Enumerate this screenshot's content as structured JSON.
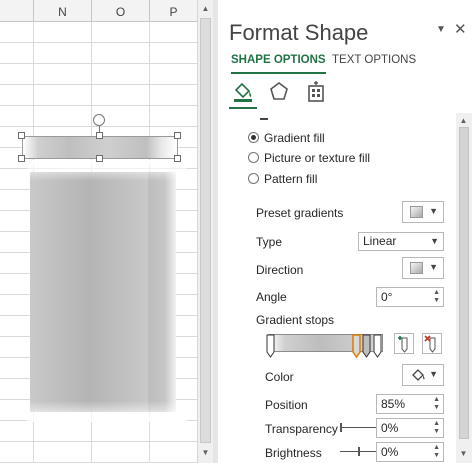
{
  "sheet": {
    "columns": [
      "N",
      "O",
      "P"
    ],
    "scroll_up": "▲",
    "scroll_down": "▼"
  },
  "pane": {
    "title": "Format Shape",
    "dropdown_glyph": "▼",
    "close_glyph": "✕",
    "tabs": [
      {
        "label": "SHAPE OPTIONS",
        "active": true
      },
      {
        "label": "TEXT OPTIONS",
        "active": false
      }
    ],
    "icons": [
      "fill-line-icon",
      "effects-icon",
      "size-properties-icon"
    ],
    "fill_options": [
      {
        "label": "Gradient fill",
        "selected": true
      },
      {
        "label": "Picture or texture fill",
        "selected": false
      },
      {
        "label": "Pattern fill",
        "selected": false
      }
    ],
    "preset_gradients_label": "Preset gradients",
    "type_label": "Type",
    "type_value": "Linear",
    "direction_label": "Direction",
    "angle_label": "Angle",
    "angle_value": "0°",
    "gradient_stops_label": "Gradient stops",
    "color_label": "Color",
    "position_label": "Position",
    "position_value": "85%",
    "transparency_label": "Transparency",
    "transparency_value": "0%",
    "brightness_label": "Brightness",
    "brightness_value": "0%",
    "dropdown_arrow": "▼",
    "spin_arrows": "▲\n▼",
    "pane_scroll_up": "▲",
    "pane_scroll_down": "▼",
    "accent_color": "#217346"
  }
}
